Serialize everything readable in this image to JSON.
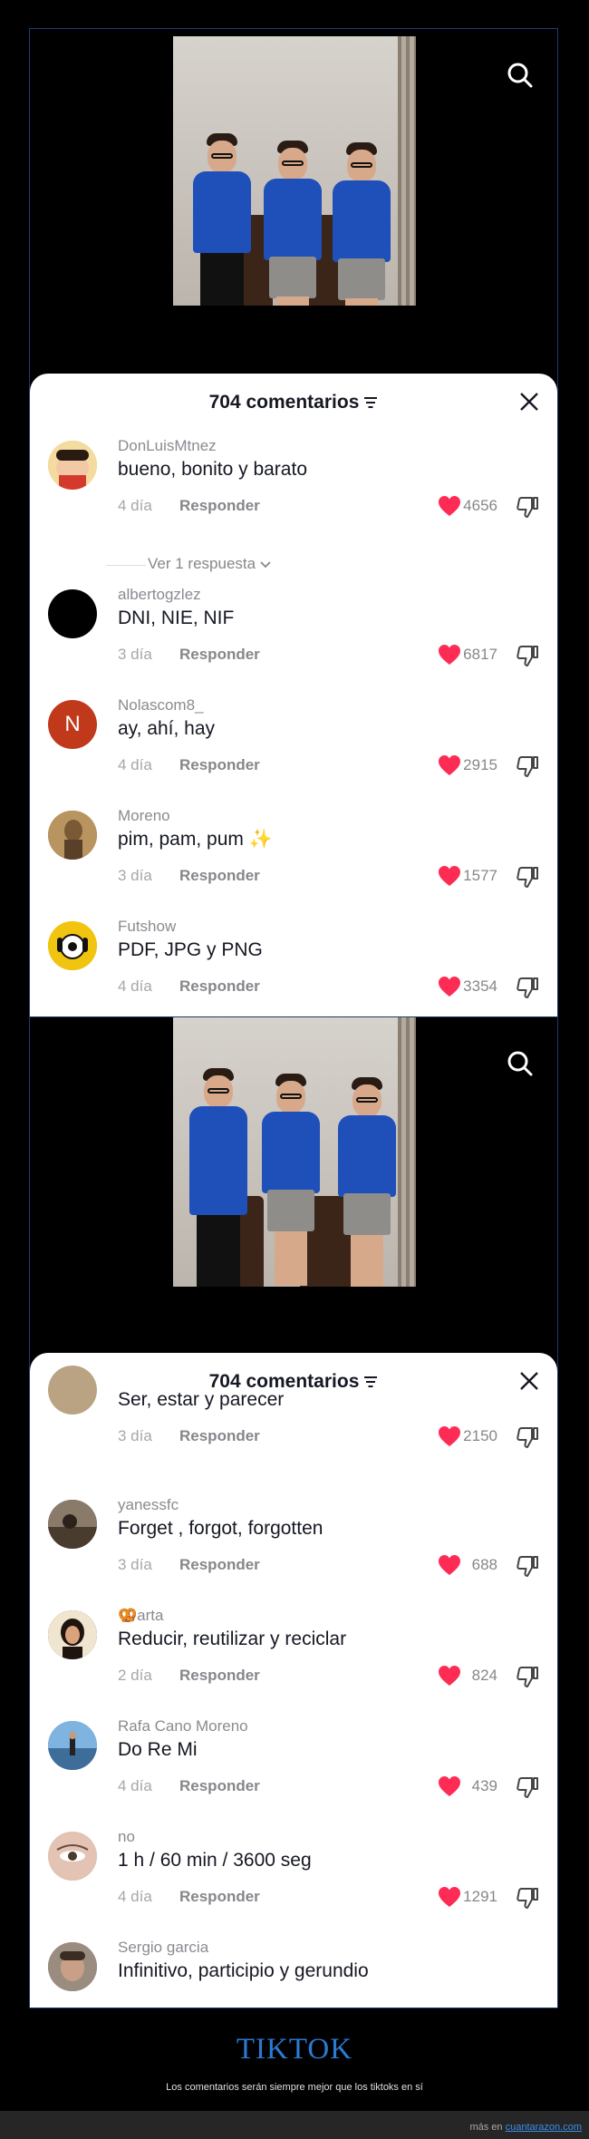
{
  "screens": [
    {
      "header": {
        "title": "704 comentarios"
      },
      "comments": [
        {
          "user": "DonLuisMtnez",
          "text": "bueno, bonito y barato",
          "age": "4 día",
          "reply": "Responder",
          "likes": "4656",
          "avatar": "#e9c86b"
        },
        {
          "user": "albertogzlez",
          "text": "DNI, NIE, NIF",
          "age": "3 día",
          "reply": "Responder",
          "likes": "6817",
          "avatar": "#000000"
        },
        {
          "user": "Nolascom8_",
          "text": "ay, ahí, hay",
          "age": "4 día",
          "reply": "Responder",
          "likes": "2915",
          "avatar": "#c0391b",
          "initial": "N"
        },
        {
          "user": "Moreno",
          "text": "pim, pam, pum ✨",
          "age": "3 día",
          "reply": "Responder",
          "likes": "1577",
          "avatar": "#9c7b4a"
        },
        {
          "user": "Futshow",
          "text": "PDF, JPG y PNG",
          "age": "4 día",
          "reply": "Responder",
          "likes": "3354",
          "avatar": "#f1c40f"
        }
      ],
      "view_replies": "Ver 1 respuesta"
    },
    {
      "header": {
        "title": "704 comentarios"
      },
      "comments": [
        {
          "user": "",
          "text": "Ser, estar y parecer",
          "age": "3 día",
          "reply": "Responder",
          "likes": "2150",
          "avatar": "#b9a383"
        },
        {
          "user": "yanessfc",
          "text": "Forget , forgot, forgotten",
          "age": "3 día",
          "reply": "Responder",
          "likes": "688",
          "avatar": "#6b5a4c"
        },
        {
          "user": "🥨arta",
          "text": "Reducir, reutilizar y reciclar",
          "age": "2 día",
          "reply": "Responder",
          "likes": "824",
          "avatar": "#3d2a1f"
        },
        {
          "user": "Rafa Cano Moreno",
          "text": "Do Re Mi",
          "age": "4 día",
          "reply": "Responder",
          "likes": "439",
          "avatar": "#5b8fc5"
        },
        {
          "user": "no",
          "text": "1 h / 60 min / 3600 seg",
          "age": "4 día",
          "reply": "Responder",
          "likes": "1291",
          "avatar": "#d8b7a8"
        },
        {
          "user": "Sergio garcia",
          "text": "Infinitivo, participio y gerundio",
          "age": "",
          "reply": "",
          "likes": "",
          "avatar": "#7d6f63"
        }
      ]
    }
  ],
  "footer": {
    "title": "TIKTOK",
    "subtitle": "Los comentarios serán siempre mejor que los tiktoks en sí",
    "source_prefix": "más en",
    "source_link": "cuantarazon.com"
  },
  "colors": {
    "heart": "#fe2c55",
    "link": "#2a7bd3"
  }
}
